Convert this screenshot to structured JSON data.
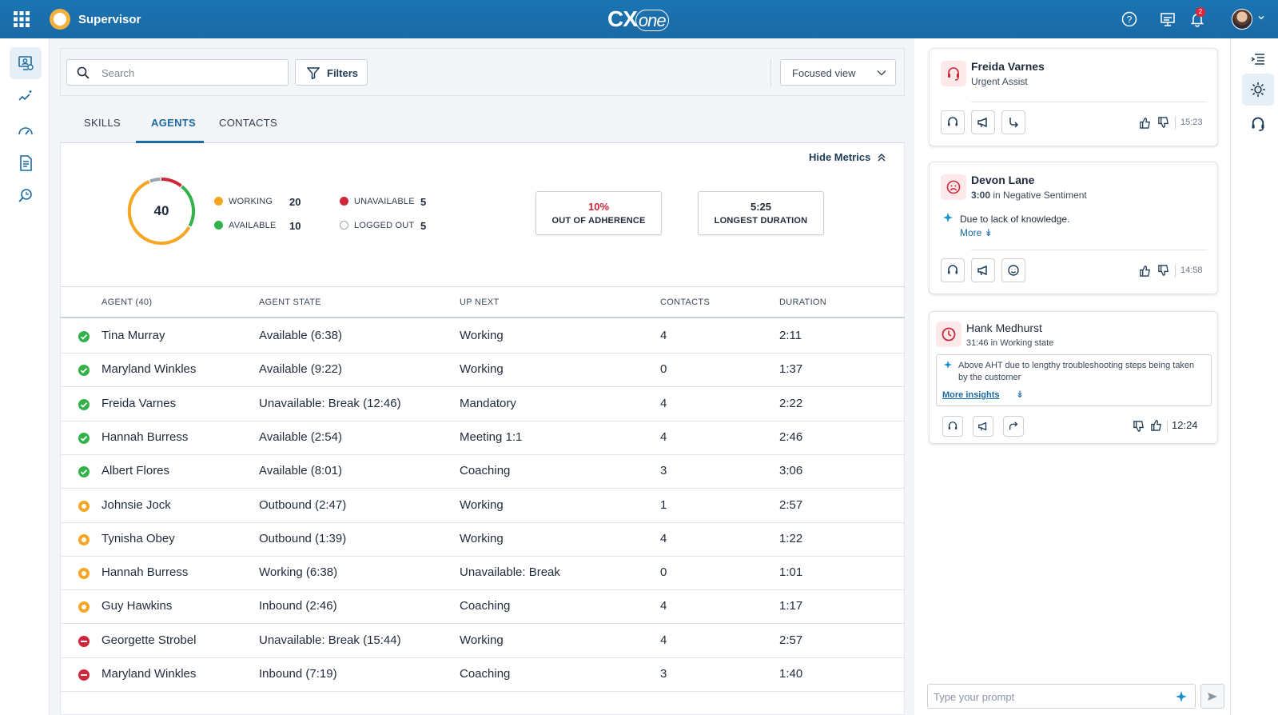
{
  "app": {
    "title": "Supervisor",
    "brand": "CX",
    "brand_suffix": "one",
    "notification_count": "2"
  },
  "colors": {
    "topbar": "#1a6aa6",
    "accent": "#1a6aa6",
    "working": "#f5a623",
    "available": "#33b24a",
    "unavailable": "#d0263a",
    "logged_out": "#9aa3ad"
  },
  "toolbar": {
    "search_placeholder": "Search",
    "filters_label": "Filters",
    "view_select": "Focused view"
  },
  "tabs": [
    {
      "label": "SKILLS"
    },
    {
      "label": "AGENTS"
    },
    {
      "label": "CONTACTS"
    }
  ],
  "active_tab": "AGENTS",
  "metrics": {
    "hide_label": "Hide Metrics",
    "total": "40",
    "legend": [
      {
        "label": "WORKING",
        "value": "20",
        "status": "working"
      },
      {
        "label": "AVAILABLE",
        "value": "10",
        "status": "available"
      },
      {
        "label": "UNAVAILABLE",
        "value": "5",
        "status": "unavailable"
      },
      {
        "label": "LOGGED OUT",
        "value": "5",
        "status": "logged_out"
      }
    ],
    "adherence": {
      "value": "10%",
      "label": "OUT OF ADHERENCE"
    },
    "longest": {
      "value": "5:25",
      "label": "LONGEST DURATION"
    }
  },
  "table": {
    "columns": [
      "AGENT (40)",
      "AGENT STATE",
      "UP NEXT",
      "CONTACTS",
      "DURATION"
    ],
    "rows": [
      {
        "status": "available",
        "name": "Tina Murray",
        "state": "Available (6:38)",
        "next": "Working",
        "contacts": "4",
        "duration": "2:11"
      },
      {
        "status": "available",
        "name": "Maryland Winkles",
        "state": "Available (9:22)",
        "next": "Working",
        "contacts": "0",
        "duration": "1:37"
      },
      {
        "status": "available",
        "name": "Freida Varnes",
        "state": "Unavailable: Break (12:46)",
        "next": "Mandatory",
        "contacts": "4",
        "duration": "2:22"
      },
      {
        "status": "available",
        "name": "Hannah Burress",
        "state": "Available (2:54)",
        "next": "Meeting 1:1",
        "contacts": "4",
        "duration": "2:46"
      },
      {
        "status": "available",
        "name": "Albert Flores",
        "state": "Available (8:01)",
        "next": "Coaching",
        "contacts": "3",
        "duration": "3:06"
      },
      {
        "status": "working",
        "name": "Johnsie Jock",
        "state": "Outbound (2:47)",
        "next": "Working",
        "contacts": "1",
        "duration": "2:57"
      },
      {
        "status": "working",
        "name": "Tynisha Obey",
        "state": "Outbound (1:39)",
        "next": "Working",
        "contacts": "4",
        "duration": "1:22"
      },
      {
        "status": "working",
        "name": "Hannah Burress",
        "state": "Working (6:38)",
        "next": "Unavailable: Break",
        "contacts": "0",
        "duration": "1:01"
      },
      {
        "status": "working",
        "name": "Guy Hawkins",
        "state": "Inbound (2:46)",
        "next": "Coaching",
        "contacts": "4",
        "duration": "1:17"
      },
      {
        "status": "unavailable",
        "name": "Georgette Strobel",
        "state": "Unavailable: Break (15:44)",
        "next": "Working",
        "contacts": "4",
        "duration": "2:57"
      },
      {
        "status": "unavailable",
        "name": "Maryland Winkles",
        "state": "Inbound (7:19)",
        "next": "Coaching",
        "contacts": "3",
        "duration": "1:40"
      }
    ]
  },
  "cards": [
    {
      "name": "Freida Varnes",
      "subtitle": "Urgent Assist",
      "time": "15:23",
      "icon": "headset-alert-icon"
    },
    {
      "name": "Devon Lane",
      "sub_bold": "3:00",
      "sub_rest": " in Negative Sentiment",
      "insight": "Due to lack of knowledge.",
      "more": "More",
      "time": "14:58",
      "icon": "sad-face-icon"
    },
    {
      "name": "Hank Medhurst",
      "subtitle": "31:46 in Working state",
      "insight": "Above AHT due to lengthy troubleshooting steps being taken by the customer",
      "more": "More insights",
      "time": "12:24",
      "icon": "clock-icon"
    }
  ],
  "prompt": {
    "placeholder": "Type your prompt"
  }
}
